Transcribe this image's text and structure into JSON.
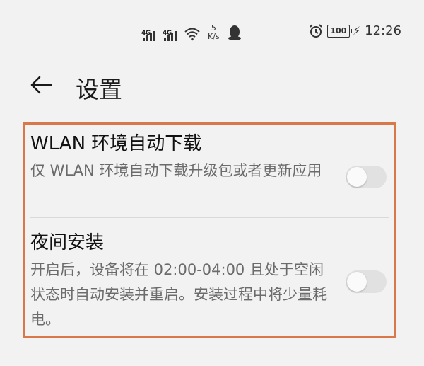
{
  "status_bar": {
    "network1": "4G",
    "network2": "4G",
    "speed_value": "5",
    "speed_unit": "K/s",
    "battery": "100",
    "time": "12:26"
  },
  "header": {
    "title": "设置"
  },
  "settings": {
    "items": [
      {
        "title": "WLAN 环境自动下载",
        "description": "仅 WLAN 环境自动下载升级包或者更新应用",
        "enabled": false
      },
      {
        "title": "夜间安装",
        "description": "开启后，设备将在 02:00-04:00 且处于空闲状态时自动安装并重启。安装过程中将少量耗电。",
        "enabled": false
      }
    ]
  },
  "colors": {
    "highlight_border": "#d9784b",
    "background": "#f2f2f2",
    "toggle_off": "#e1e1e1"
  },
  "icons": [
    "signal-icon",
    "wifi-icon",
    "qq-icon",
    "alarm-icon",
    "battery-icon",
    "charging-icon",
    "back-arrow-icon"
  ]
}
